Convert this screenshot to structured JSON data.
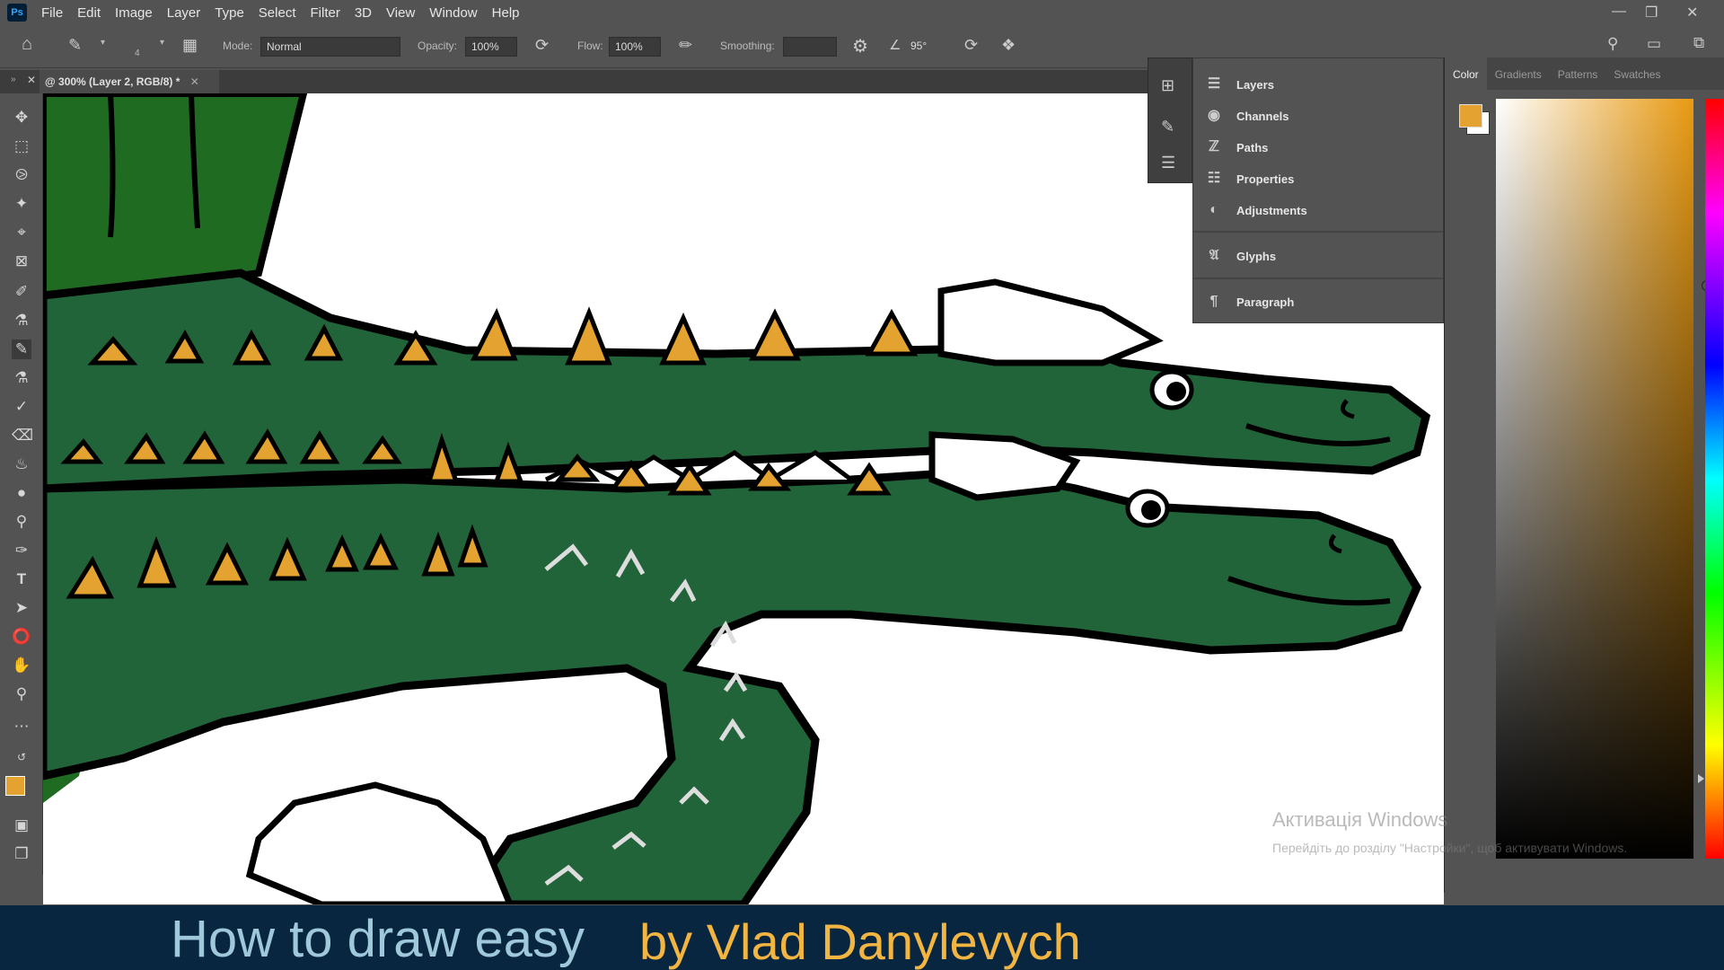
{
  "menubar": {
    "logo": "Ps",
    "items": [
      "File",
      "Edit",
      "Image",
      "Layer",
      "Type",
      "Select",
      "Filter",
      "3D",
      "View",
      "Window",
      "Help"
    ]
  },
  "options": {
    "mode_label": "Mode:",
    "mode_value": "Normal",
    "opacity_label": "Opacity:",
    "opacity_value": "100%",
    "flow_label": "Flow:",
    "flow_value": "100%",
    "smoothing_label": "Smoothing:",
    "angle_value": "95°",
    "brush_size": "4"
  },
  "document": {
    "tab_title": "@ 300% (Layer 2, RGB/8) *"
  },
  "panels": {
    "items": [
      {
        "label": "Layers",
        "icon": "layers-icon"
      },
      {
        "label": "Channels",
        "icon": "channels-icon"
      },
      {
        "label": "Paths",
        "icon": "paths-icon"
      },
      {
        "label": "Properties",
        "icon": "properties-icon"
      },
      {
        "label": "Adjustments",
        "icon": "adjustments-icon"
      },
      {
        "label": "Glyphs",
        "icon": "glyphs-icon"
      },
      {
        "label": "Paragraph",
        "icon": "paragraph-icon"
      }
    ]
  },
  "color_panel": {
    "tabs": [
      "Color",
      "Gradients",
      "Patterns",
      "Swatches"
    ],
    "active_tab": "Color",
    "foreground": "#e4a231",
    "background": "#ffffff"
  },
  "watermark": {
    "title": "Активація Windows",
    "subtitle": "Перейдіть до розділу \"Настройки\", щоб активувати Windows."
  },
  "caption": {
    "left": "How to draw easy",
    "right": "by Vlad Danylevych"
  },
  "colors": {
    "croc_green": "#22643a",
    "spike_orange": "#e4a231",
    "outline": "#000000"
  }
}
